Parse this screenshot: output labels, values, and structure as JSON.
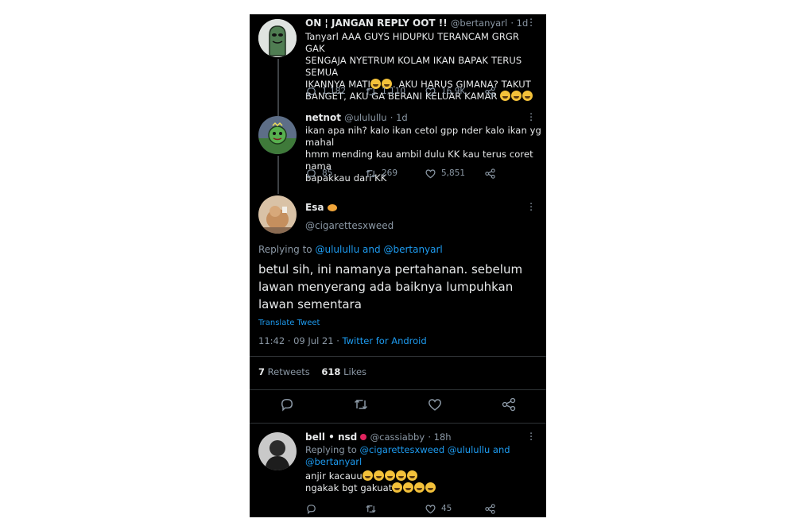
{
  "tweet1": {
    "name": "ON ¦ JANGAN REPLY OOT !!",
    "handle": "@bertanyarl",
    "time": "· 1d",
    "lines": [
      "Tanyarl AAA GUYS HIDUPKU TERANCAM GRGR GAK",
      "SENGAJA NYETRUM KOLAM IKAN BAPAK TERUS SEMUA",
      "IKANNYA MATI",
      ". AKU HARUS GIMANA? TAKUT",
      "BANGET, AKU GA BERANI KELUAR KAMAR"
    ],
    "replies": "1,182",
    "retweets": "1,110",
    "likes": "16.9K"
  },
  "tweet2": {
    "name": "netnot",
    "handle": "@ululullu",
    "time": "· 1d",
    "lines": [
      "ikan apa nih? kalo ikan cetol gpp nder kalo ikan yg mahal",
      "hmm mending kau ambil dulu KK kau terus coret nama",
      "bapakkau dari KK"
    ],
    "replies": "85",
    "retweets": "269",
    "likes": "5,851"
  },
  "main": {
    "name": "Esa",
    "handle": "@cigarettesxweed",
    "replying_prefix": "Replying to",
    "replying_users": "@ululullu and @bertanyarl",
    "lines": [
      "betul sih, ini namanya pertahanan. sebelum",
      "lawan menyerang ada baiknya lumpuhkan",
      "lawan sementara"
    ],
    "translate": "Translate Tweet",
    "timestamp": "11:42 · 09 Jul 21 · ",
    "client": "Twitter for Android",
    "retweets_count": "7",
    "retweets_label": "Retweets",
    "likes_count": "618",
    "likes_label": "Likes"
  },
  "reply": {
    "name": "bell • nsd",
    "handle": "@cassiabby",
    "time": "· 18h",
    "replying_prefix": "Replying to",
    "replying_users_1": "@cigarettesxweed @ululullu and",
    "replying_users_2": "@bertanyarl",
    "line1": "anjir kacauu",
    "line2": "ngakak bgt gakuat",
    "likes": "45"
  },
  "colors": {
    "background": "#000000",
    "accent": "#1d9bf0",
    "muted": "#8b98a5"
  },
  "icons": [
    "reply-icon",
    "retweet-icon",
    "like-icon",
    "share-icon",
    "more-icon"
  ]
}
